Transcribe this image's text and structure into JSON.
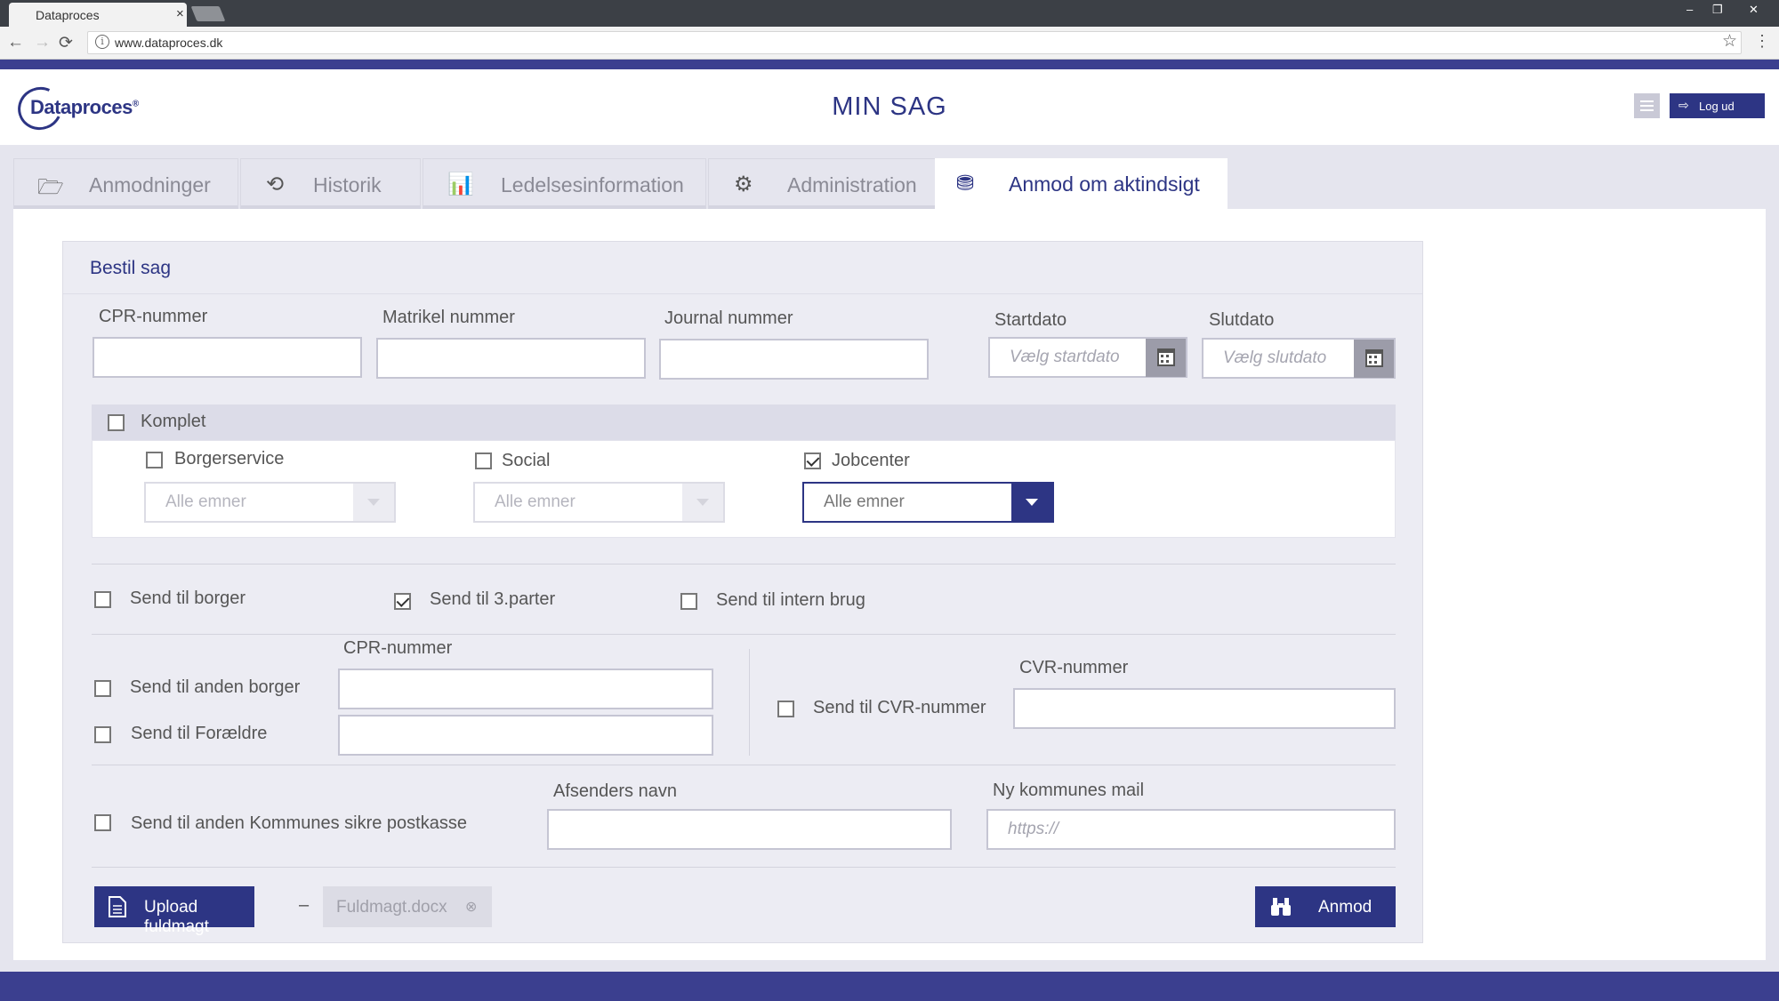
{
  "browser": {
    "tab_title": "Dataproces",
    "tab_close": "×",
    "url": "www.dataproces.dk",
    "info_glyph": "i",
    "back": "←",
    "forward": "→",
    "reload": "⟳",
    "star": "☆",
    "menu": "⋮",
    "win_min": "‒",
    "win_max": "❐",
    "win_close": "✕"
  },
  "header": {
    "logo_text": "Dataproces",
    "logo_mark": "®",
    "title": "MIN SAG",
    "logout_icon": "⇨",
    "logout_label": "Log ud"
  },
  "tabs": [
    {
      "label": "Anmodninger",
      "icon": "folder-open-icon",
      "glyph": "🗁"
    },
    {
      "label": "Historik",
      "icon": "history-icon",
      "glyph": "⟲"
    },
    {
      "label": "Ledelsesinformation",
      "icon": "bar-chart-icon",
      "glyph": "📊"
    },
    {
      "label": "Administration",
      "icon": "gears-icon",
      "glyph": "⚙"
    },
    {
      "label": "Anmod om aktindsigt",
      "icon": "binoculars-icon",
      "glyph": "⛃"
    }
  ],
  "form": {
    "title": "Bestil sag",
    "cpr_label": "CPR-nummer",
    "cpr_value": "",
    "matrikel_label": "Matrikel nummer",
    "matrikel_value": "",
    "journal_label": "Journal nummer",
    "journal_value": "",
    "startdato_label": "Startdato",
    "startdato_placeholder": "Vælg startdato",
    "slutdato_label": "Slutdato",
    "slutdato_placeholder": "Vælg slutdato",
    "komplet_label": "Komplet",
    "komplet_checked": false,
    "categories": [
      {
        "label": "Borgerservice",
        "checked": false,
        "select": "Alle emner"
      },
      {
        "label": "Social",
        "checked": false,
        "select": "Alle emner"
      },
      {
        "label": "Jobcenter",
        "checked": true,
        "select": "Alle emner"
      }
    ],
    "send_options": [
      {
        "label": "Send til borger",
        "checked": false
      },
      {
        "label": "Send til 3.parter",
        "checked": true
      },
      {
        "label": "Send til intern brug",
        "checked": false
      }
    ],
    "other_cpr_label": "CPR-nummer",
    "send_anden_borger": "Send til anden borger",
    "send_foraeldre": "Send til Forældre",
    "cvr_label": "CVR-nummer",
    "send_cvr": "Send til CVR-nummer",
    "send_kommune": "Send til anden Kommunes sikre postkasse",
    "afsender_label": "Afsenders navn",
    "mail_label": "Ny kommunes mail",
    "mail_placeholder": "https://",
    "upload_label": "Upload fuldmagt",
    "dash": "–",
    "file_name": "Fuldmagt.docx",
    "anmod_label": "Anmod"
  },
  "colors": {
    "brand": "#2d3584",
    "stripe": "#3b3f8f",
    "background": "#e5e5ee"
  }
}
